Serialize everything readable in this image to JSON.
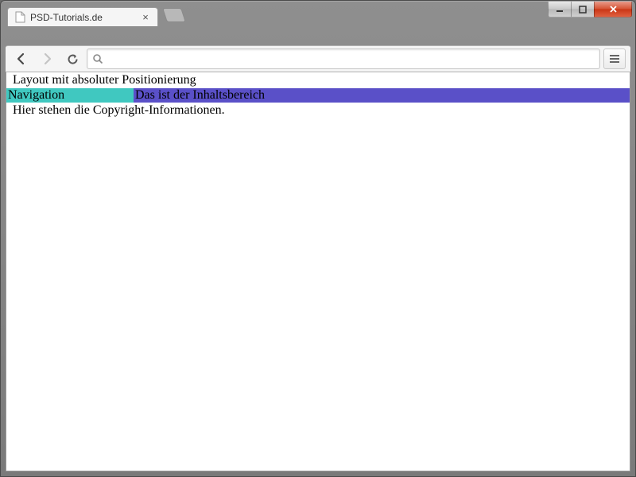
{
  "browser": {
    "tab_title": "PSD-Tutorials.de",
    "omnibox_value": ""
  },
  "page": {
    "header": "Layout mit absoluter Positionierung",
    "nav": "Navigation",
    "content": "Das ist der Inhaltsbereich",
    "footer": "Hier stehen die Copyright-Informationen."
  },
  "colors": {
    "nav_bg": "#40c8c0",
    "content_bg": "#5a50c8"
  }
}
